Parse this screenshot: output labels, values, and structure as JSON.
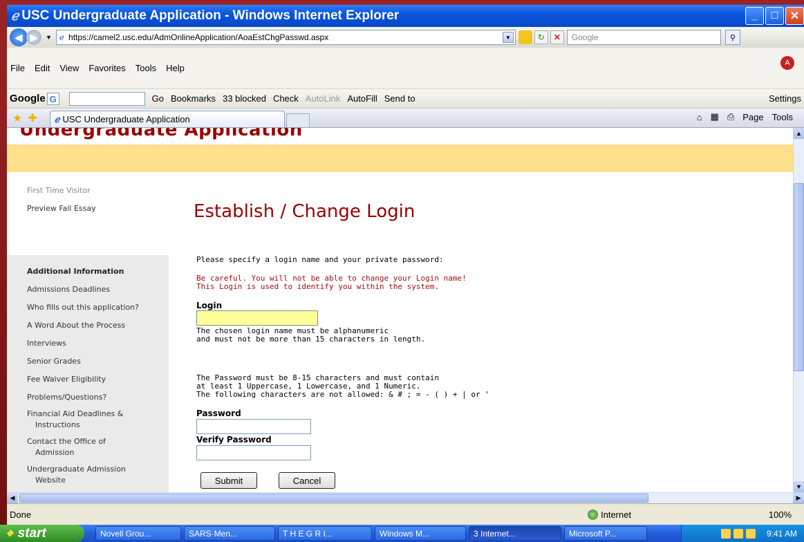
{
  "window": {
    "title": "USC Undergraduate Application - Windows Internet Explorer",
    "title_icon": "ie-icon"
  },
  "address": {
    "url": "https://camel2.usc.edu/AdmOnlineApplication/AoaEstChgPasswd.aspx",
    "search_placeholder": "Google"
  },
  "menu": [
    "File",
    "Edit",
    "View",
    "Favorites",
    "Tools",
    "Help"
  ],
  "google_toolbar": {
    "logo": "Google",
    "go": "Go",
    "bookmarks": "Bookmarks",
    "blocked": "33 blocked",
    "check": "Check",
    "autolink": "AutoLink",
    "autofill": "AutoFill",
    "sendto": "Send to",
    "settings": "Settings"
  },
  "tabs": {
    "active_title": "USC Undergraduate Application",
    "page": "Page",
    "tools": "Tools"
  },
  "page": {
    "header": "Undergraduate Application",
    "title": "Establish / Change Login",
    "intro": "Please specify a login name and your private password:",
    "warning1": "Be careful. You will not be able to change your Login name!",
    "warning2": "This Login is used to identify you within the system.",
    "login_label": "Login",
    "login_help1": "The chosen login name must be alphanumeric",
    "login_help2": "and must not be more than 15 characters in length.",
    "pw_rule1": "The Password must be 8-15 characters and must contain",
    "pw_rule2": "at least 1 Uppercase, 1 Lowercase, and 1 Numeric.",
    "pw_rule3": "The following characters are not allowed: & # ; = - ( ) + | or '",
    "password_label": "Password",
    "verify_label": "Verify Password",
    "submit": "Submit",
    "cancel": "Cancel",
    "login_value": "",
    "password_value": "",
    "verify_value": ""
  },
  "sidebar": {
    "top": [
      "First Time Visitor",
      "Preview Fall Essay"
    ],
    "section_title": "Additional Information",
    "items": [
      "Admissions Deadlines",
      "Who fills out this application?",
      "A Word About the Process",
      "Interviews",
      "Senior Grades",
      "Fee Waiver Eligibility",
      "Problems/Questions?",
      "Financial Aid Deadlines &",
      "Instructions",
      "Contact the Office of",
      "Admission",
      "Undergraduate Admission",
      "Website"
    ]
  },
  "status": {
    "text": "Done",
    "zone": "Internet",
    "zoom": "100%"
  },
  "taskbar": {
    "start": "start",
    "tasks": [
      "Novell Grou...",
      "SARS·Men...",
      "T H E  G R I...",
      "Windows M...",
      "3 Internet...",
      "Microsoft P..."
    ],
    "clock": "9:41 AM"
  }
}
